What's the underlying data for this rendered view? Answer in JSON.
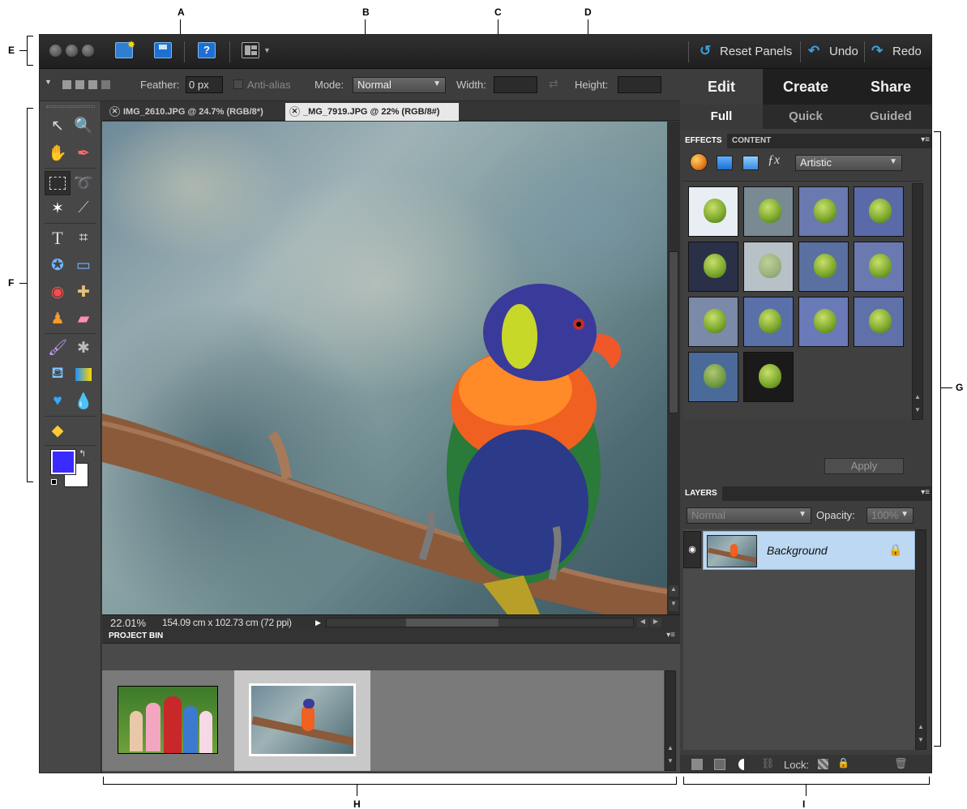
{
  "callouts": {
    "a": "A",
    "b": "B",
    "c": "C",
    "d": "D",
    "e": "E",
    "f": "F",
    "g": "G",
    "h": "H",
    "i": "I"
  },
  "topbar": {
    "reset_panels": "Reset Panels",
    "undo": "Undo",
    "redo": "Redo",
    "help": "?"
  },
  "options": {
    "feather_label": "Feather:",
    "feather_value": "0 px",
    "anti_alias": "Anti-alias",
    "mode_label": "Mode:",
    "mode_value": "Normal",
    "width_label": "Width:",
    "height_label": "Height:"
  },
  "mode_tabs": [
    "Edit",
    "Create",
    "Share"
  ],
  "sub_tabs": [
    "Full",
    "Quick",
    "Guided"
  ],
  "doc_tabs": [
    "IMG_2610.JPG @ 24.7% (RGB/8*)",
    "_MG_7919.JPG @ 22% (RGB/8#)"
  ],
  "status": {
    "zoom": "22.01%",
    "dimensions": "154.09 cm x 102.73 cm (72 ppi)"
  },
  "project_bin": {
    "title": "PROJECT BIN"
  },
  "effects": {
    "tabs": [
      "EFFECTS",
      "CONTENT"
    ],
    "category": "Artistic",
    "apply": "Apply"
  },
  "layers": {
    "title": "LAYERS",
    "blend_mode": "Normal",
    "opacity_label": "Opacity:",
    "opacity_value": "100%",
    "layer_name": "Background",
    "lock_label": "Lock:"
  },
  "colors": {
    "foreground": "#3a2cff",
    "background": "#ffffff",
    "accent": "#39a0e0",
    "selection": "#bcd8f2"
  }
}
